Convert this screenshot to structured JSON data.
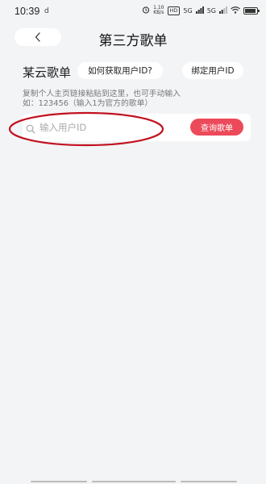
{
  "status_bar": {
    "time": "10:39",
    "sub_indicator": "d",
    "speed_value": "1.10",
    "speed_unit": "KB/s",
    "network_badge": "HD",
    "signal_1": "5G",
    "signal_2": "5G",
    "battery_text": "",
    "battery_level": 0.9
  },
  "header": {
    "back_icon": "chevron-left-icon",
    "title": "第三方歌单"
  },
  "section": {
    "title": "某云歌单",
    "help_button": "如何获取用户ID?",
    "bind_button": "绑定用户ID",
    "hint_line1": "复制个人主页链接粘贴到这里，也可手动输入",
    "hint_line2": "如：123456（输入1为官方的歌单）"
  },
  "search": {
    "placeholder": "输入用户ID",
    "value": "",
    "icon": "search-icon",
    "query_button": "查询歌单"
  },
  "colors": {
    "background": "#f3f4f6",
    "accent": "#ec4a5a",
    "annotation": "#c1121f"
  }
}
